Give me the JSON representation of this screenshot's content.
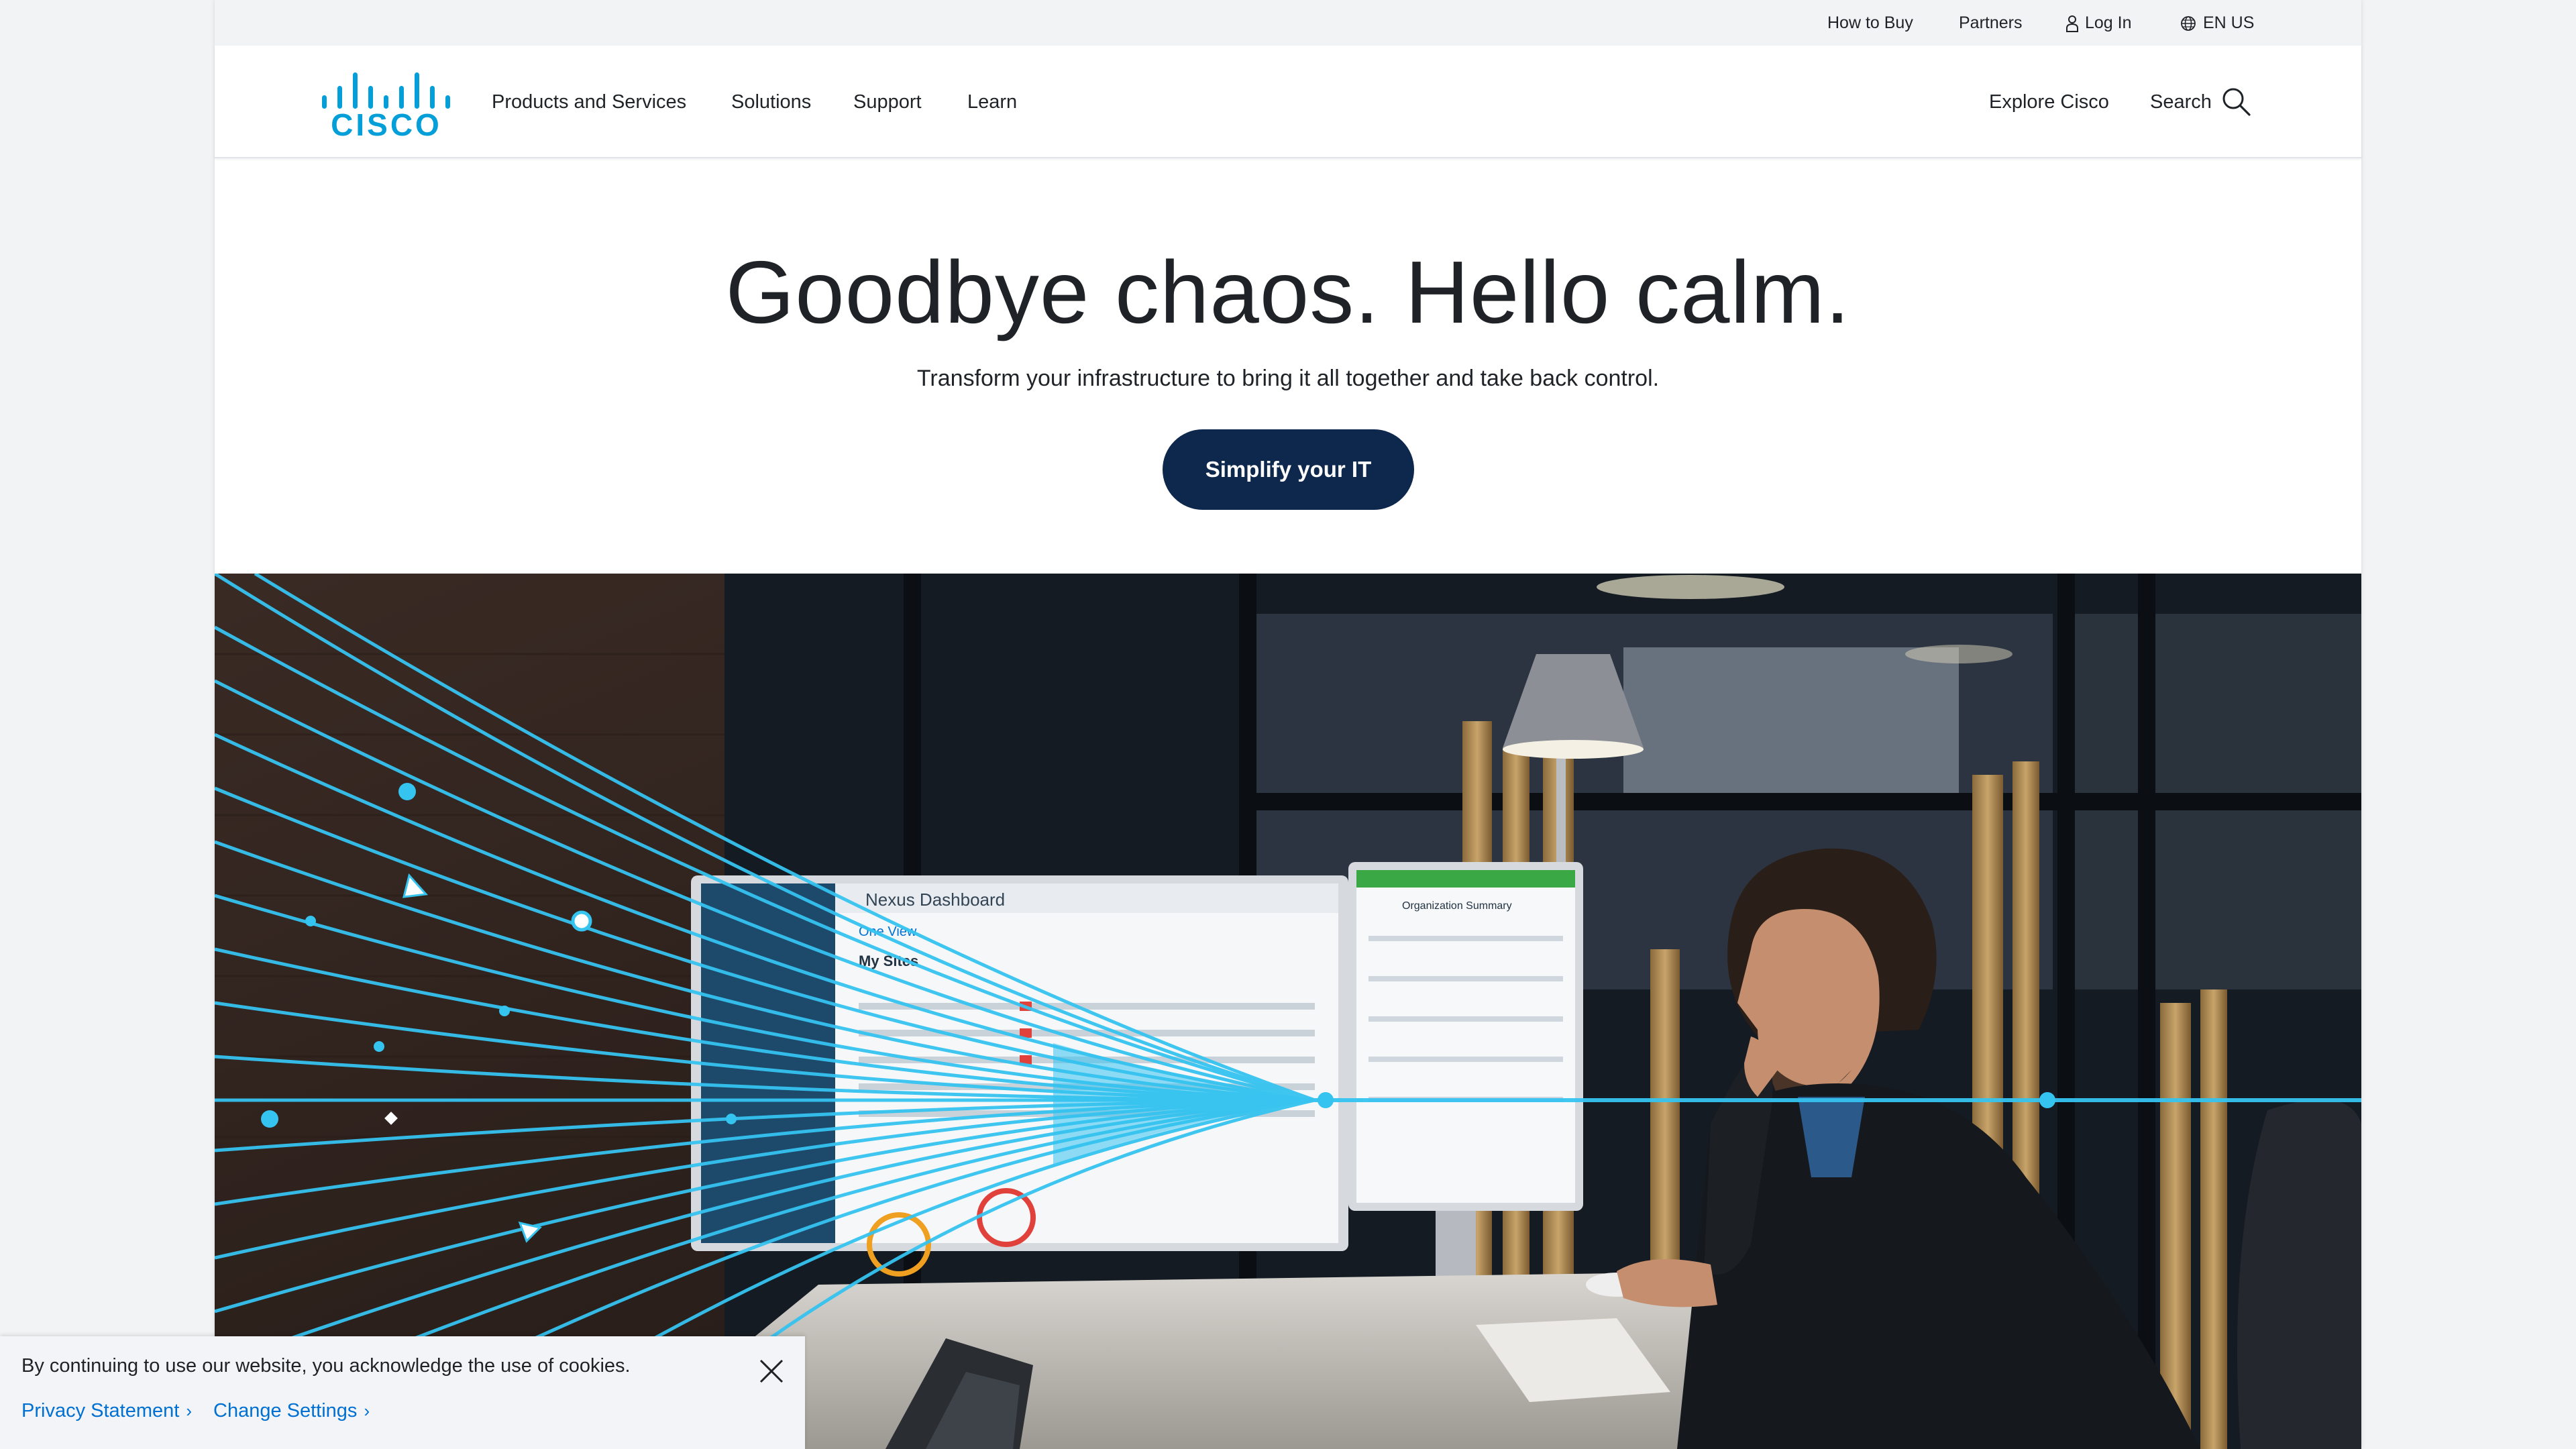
{
  "utility_bar": {
    "how_to_buy": "How to Buy",
    "partners": "Partners",
    "log_in": "Log In",
    "language": "EN US",
    "icons": {
      "log_in": "user-icon",
      "language": "globe-icon"
    }
  },
  "header": {
    "logo_text": "CISCO",
    "nav": [
      "Products and Services",
      "Solutions",
      "Support",
      "Learn"
    ],
    "explore": "Explore Cisco",
    "search": "Search",
    "search_icon": "search-icon"
  },
  "hero": {
    "title": "Goodbye chaos. Hello calm.",
    "subtitle": "Transform your infrastructure to bring it all together and take back control.",
    "cta": "Simplify your IT"
  },
  "cookie_banner": {
    "message": "By continuing to use our website, you acknowledge the use of cookies.",
    "privacy_link": "Privacy Statement",
    "settings_link": "Change Settings",
    "close_icon": "close-icon"
  },
  "colors": {
    "brand_blue": "#049fd9",
    "cta_navy": "#0d274d",
    "link_blue": "#0070d2",
    "accent_line": "#35c3f0"
  },
  "screen_texts": {
    "left_monitor_title": "Nexus Dashboard",
    "left_monitor_view": "One View",
    "left_monitor_section": "My Sites",
    "right_monitor_title": "Organization Summary"
  }
}
